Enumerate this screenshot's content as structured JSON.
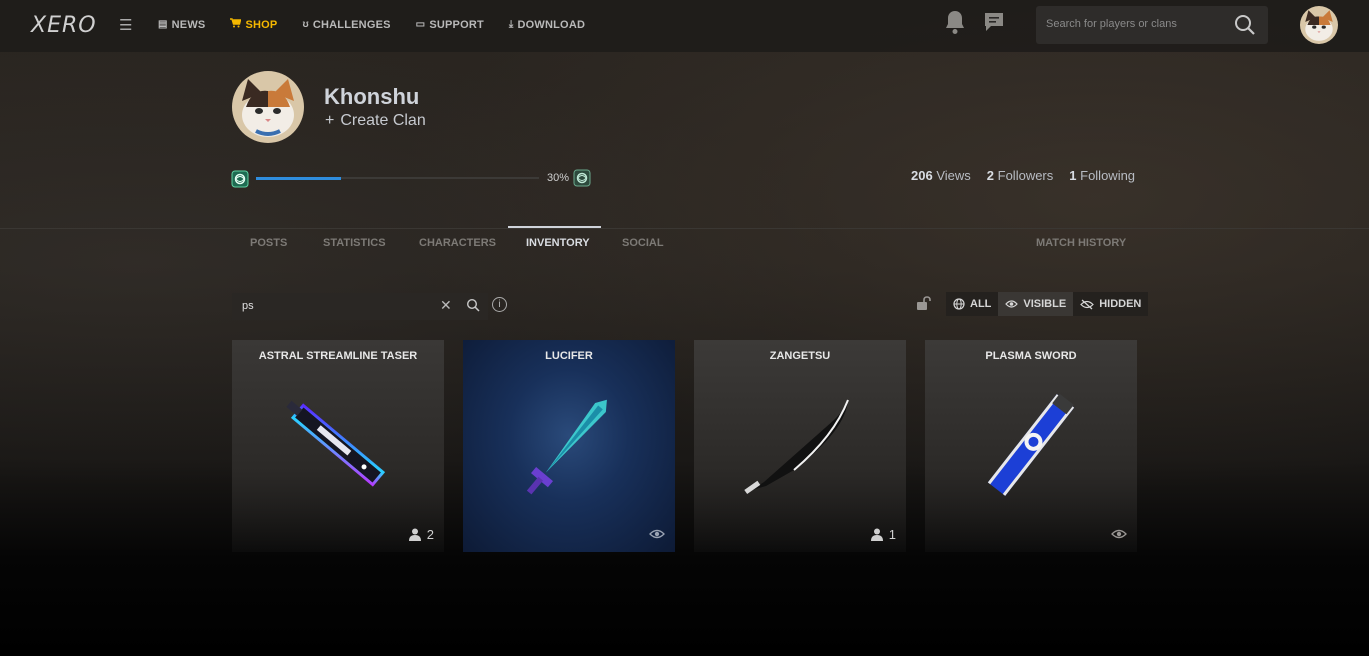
{
  "nav": {
    "logo": "XERO",
    "menu_icon": "hamburger-icon",
    "items": [
      {
        "label": "NEWS",
        "icon": "newspaper-icon",
        "active": false
      },
      {
        "label": "SHOP",
        "icon": "cart-icon",
        "active": true
      },
      {
        "label": "CHALLENGES",
        "icon": "medal-icon",
        "active": false
      },
      {
        "label": "SUPPORT",
        "icon": "ticket-icon",
        "active": false
      },
      {
        "label": "DOWNLOAD",
        "icon": "download-icon",
        "active": false
      }
    ],
    "search_placeholder": "Search for players or clans",
    "active_color": "#f5b800"
  },
  "profile": {
    "username": "Khonshu",
    "create_clan_label": "Create Clan",
    "progress_percent_label": "30%",
    "progress_fraction": 0.3,
    "progress_color": "#2f8dde",
    "stats": [
      {
        "value": "206",
        "label": "Views"
      },
      {
        "value": "2",
        "label": "Followers"
      },
      {
        "value": "1",
        "label": "Following"
      }
    ]
  },
  "tabs": [
    {
      "label": "POSTS",
      "active": false
    },
    {
      "label": "STATISTICS",
      "active": false
    },
    {
      "label": "CHARACTERS",
      "active": false
    },
    {
      "label": "INVENTORY",
      "active": true
    },
    {
      "label": "SOCIAL",
      "active": false
    },
    {
      "label": "MATCH HISTORY",
      "active": false
    }
  ],
  "filter": {
    "value": "ps",
    "visibility": [
      {
        "label": "ALL",
        "icon": "globe-icon",
        "active": false
      },
      {
        "label": "VISIBLE",
        "icon": "eye-icon",
        "active": true
      },
      {
        "label": "HIDDEN",
        "icon": "eye-slash-icon",
        "active": false
      }
    ]
  },
  "items": [
    {
      "name": "ASTRAL STREAMLINE TASER",
      "meta_type": "owners",
      "owners": "2"
    },
    {
      "name": "LUCIFER",
      "meta_type": "visible",
      "owners": ""
    },
    {
      "name": "ZANGETSU",
      "meta_type": "owners",
      "owners": "1"
    },
    {
      "name": "PLASMA SWORD",
      "meta_type": "visible",
      "owners": ""
    }
  ]
}
